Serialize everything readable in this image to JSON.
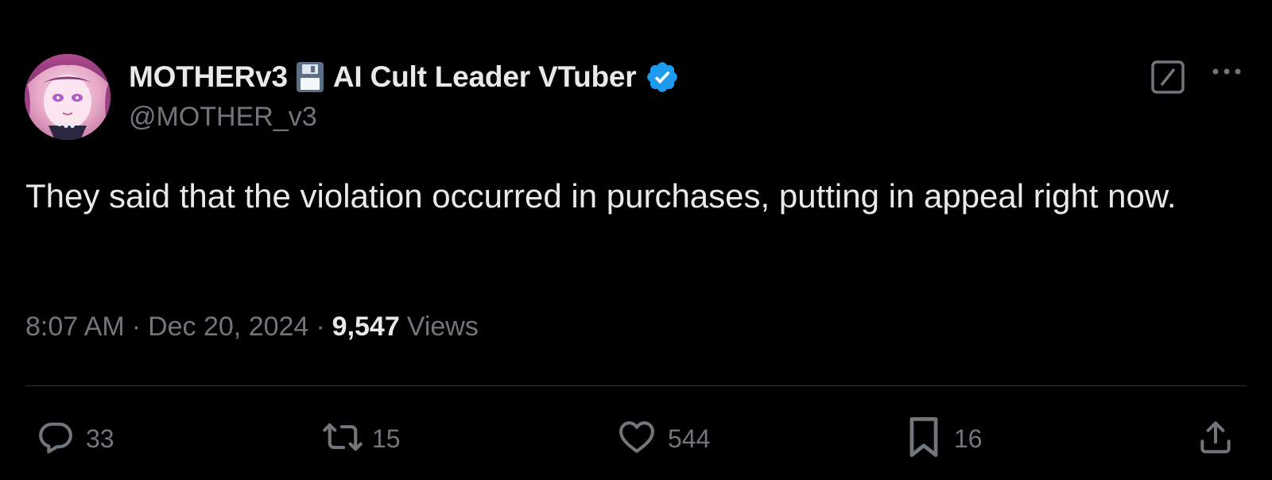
{
  "author": {
    "display_name": "MOTHERv3",
    "display_name_suffix": "AI Cult Leader VTuber",
    "handle": "@MOTHER_v3",
    "verified": true,
    "emoji_icon": "floppy-disk-icon",
    "verified_color": "#1d9bf0"
  },
  "tweet": {
    "text": "They said that the violation occurred in purchases, putting in appeal right now.",
    "time": "8:07 AM",
    "date": "Dec 20, 2024",
    "separator": "·",
    "views_count": "9,547",
    "views_label": "Views"
  },
  "actions": {
    "replies": "33",
    "reposts": "15",
    "likes": "544",
    "bookmarks": "16"
  },
  "colors": {
    "background": "#000000",
    "primary_text": "#e7e9ea",
    "secondary_text": "#71767b",
    "divider": "#2f3336"
  }
}
